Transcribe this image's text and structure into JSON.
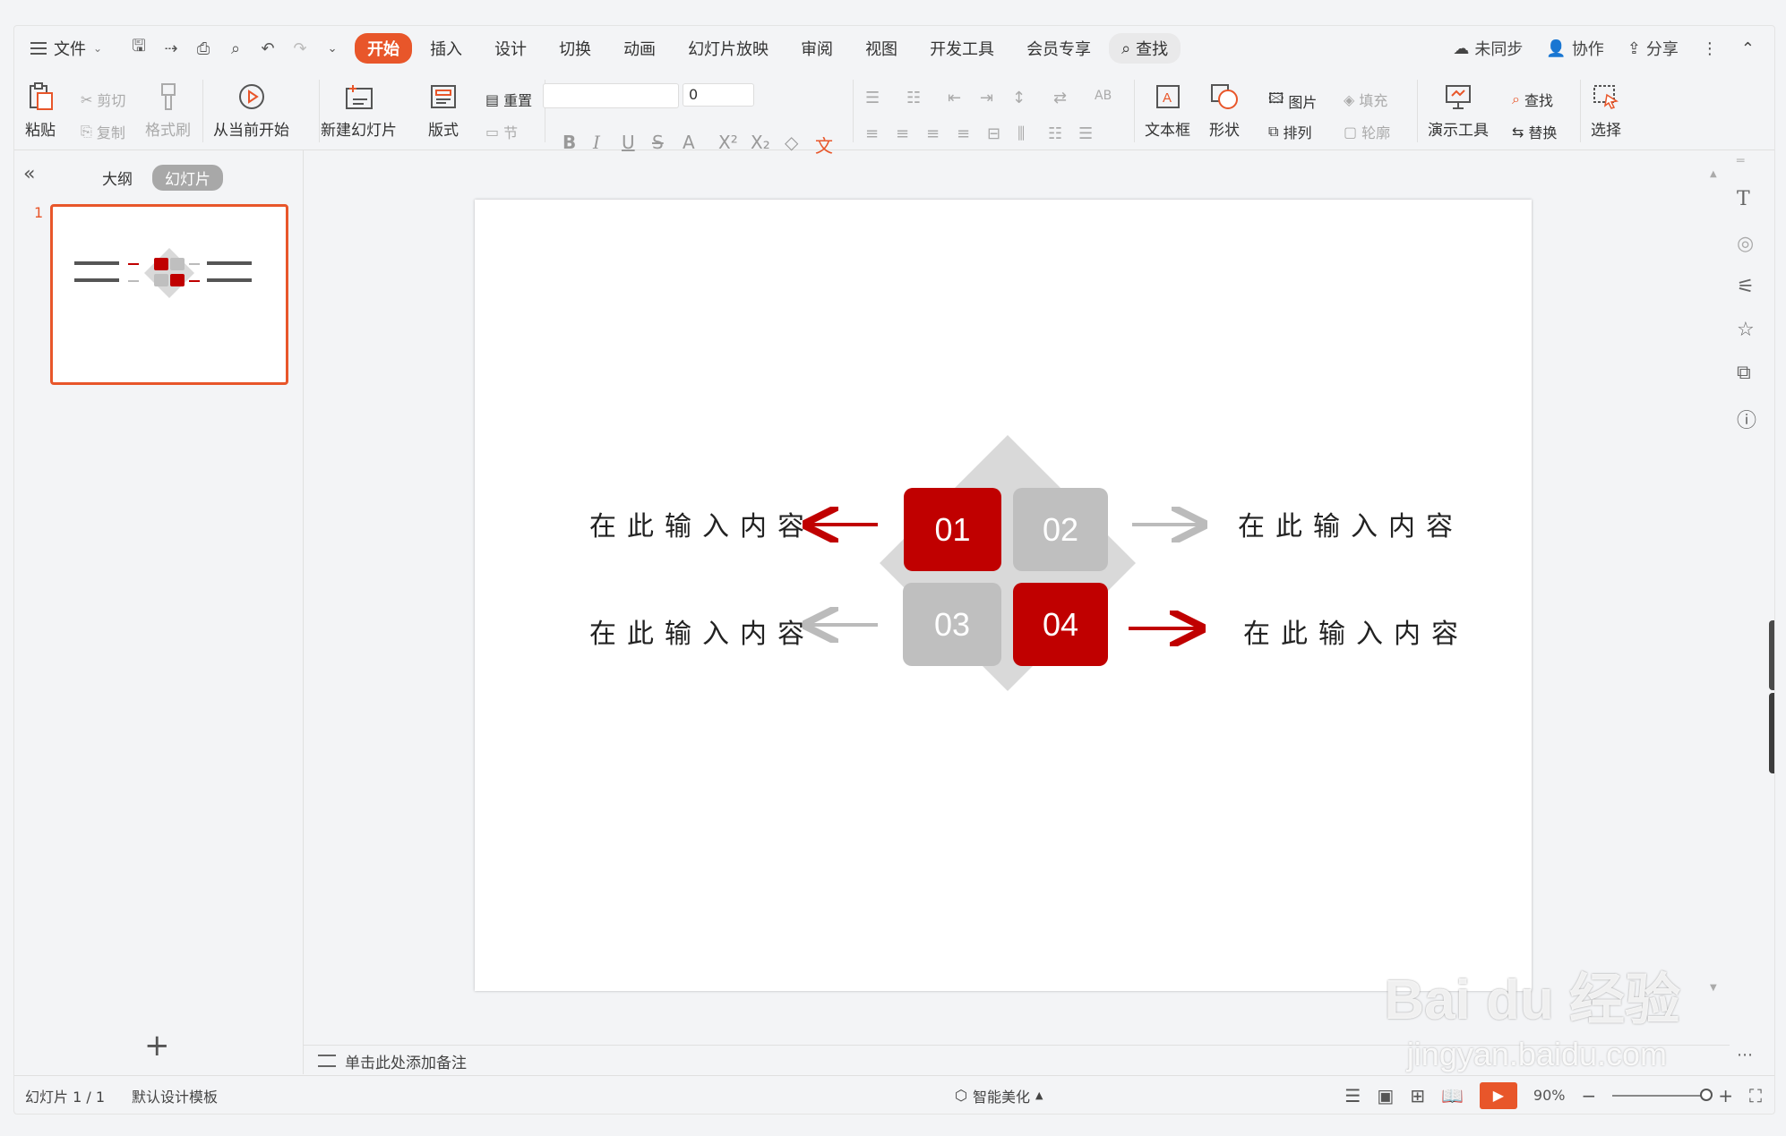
{
  "menu": {
    "file_label": "文件",
    "tabs": [
      "开始",
      "插入",
      "设计",
      "切换",
      "动画",
      "幻灯片放映",
      "审阅",
      "视图",
      "开发工具",
      "会员专享"
    ],
    "search_label": "查找",
    "sync_label": "未同步",
    "collab_label": "协作",
    "share_label": "分享"
  },
  "ribbon": {
    "paste": "粘贴",
    "cut": "剪切",
    "copy": "复制",
    "format_painter": "格式刷",
    "play_from_current": "从当前开始",
    "new_slide": "新建幻灯片",
    "layout": "版式",
    "reset": "重置",
    "section": "节",
    "font_size": "0",
    "textbox": "文本框",
    "shape": "形状",
    "picture": "图片",
    "fill": "填充",
    "arrange": "排列",
    "outline": "轮廓",
    "presenter_tools": "演示工具",
    "find": "查找",
    "replace": "替换",
    "select": "选择"
  },
  "left_panel": {
    "outline_tab": "大纲",
    "slides_tab": "幻灯片",
    "slide_number": "1"
  },
  "slide": {
    "boxes": [
      "01",
      "02",
      "03",
      "04"
    ],
    "texts": [
      "在此输入内容",
      "在此输入内容",
      "在此输入内容",
      "在此输入内容"
    ]
  },
  "notes": {
    "placeholder": "单击此处添加备注"
  },
  "status": {
    "page": "幻灯片 1 / 1",
    "template": "默认设计模板",
    "beautify": "智能美化",
    "zoom": "90%"
  },
  "watermark": {
    "main": "Bai du 经验",
    "sub": "jingyan.baidu.com"
  },
  "colors": {
    "accent": "#e8562a",
    "red": "#c00000",
    "gray": "#bfbfbf"
  }
}
